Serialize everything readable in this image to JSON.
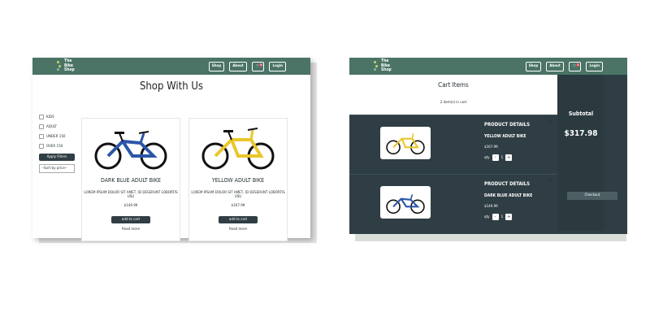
{
  "shop": {
    "logo_lines": [
      "The",
      "Bike",
      "Shop"
    ],
    "nav": {
      "shop": "Shop",
      "about": "About",
      "cart_badge": "0",
      "login": "Login"
    },
    "title": "Shop With Us",
    "filters": {
      "kids": "KIDS",
      "adult": "ADULT",
      "under150": "UNDER 150",
      "over150": "OVER 150",
      "apply": "Apply Filters",
      "sort": "--Sort by price--"
    },
    "products": [
      {
        "name": "DARK BLUE ADULT BIKE",
        "desc": "LOREM IPSUM DOLOR SIT AMET, ID DESERUNT LOBORTIS USU",
        "price": "$149.99",
        "add": "add to cart",
        "read": "Read more"
      },
      {
        "name": "YELLOW ADULT BIKE",
        "desc": "LOREM IPSUM DOLOR SIT AMET, ID DESERUNT LOBORTIS USU",
        "price": "$167.99",
        "add": "add to cart",
        "read": "Read more"
      }
    ]
  },
  "cart": {
    "logo_lines": [
      "The",
      "Bike",
      "Shop"
    ],
    "nav": {
      "shop": "Shop",
      "about": "About",
      "cart_badge": "2",
      "login": "Login"
    },
    "title": "Cart Items",
    "count_text": "2 item(s) in cart",
    "items": [
      {
        "details_label": "PRODUCT DETAILS",
        "name": "YELLOW ADULT BIKE",
        "price": "$167.99",
        "qty_label": "qty",
        "minus": "-",
        "qty": "1",
        "plus": "+",
        "remove": "x"
      },
      {
        "details_label": "PRODUCT DETAILS",
        "name": "DARK BLUE ADULT BIKE",
        "price": "$149.99",
        "qty_label": "qty",
        "minus": "-",
        "qty": "1",
        "plus": "+",
        "remove": "x"
      }
    ],
    "subtotal_label": "Subtotal",
    "subtotal_value": "$317.98",
    "checkout": "Checkout"
  },
  "colors": {
    "nav": "#4b7466",
    "dark": "#2f3e44",
    "bike_blue": "#2b56a8",
    "bike_yellow": "#e8c72a"
  },
  "icons": [
    "bike-logo-icon",
    "cart-icon",
    "checkbox-icon",
    "close-icon"
  ]
}
